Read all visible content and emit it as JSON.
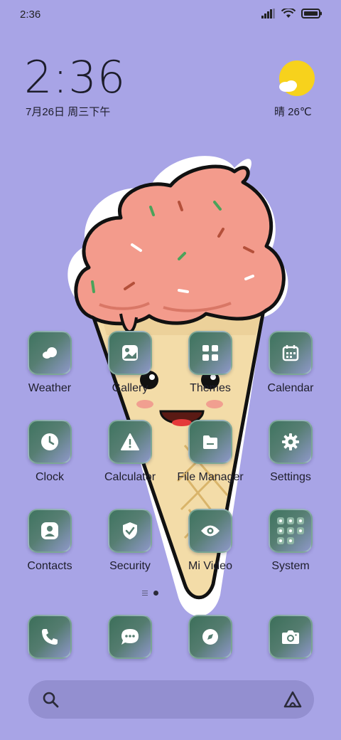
{
  "status": {
    "time": "2:36"
  },
  "clock_widget": {
    "time": "2:36",
    "date": "7月26日 周三下午"
  },
  "weather": {
    "text": "晴 26℃",
    "icon": "sun-cloud-icon"
  },
  "apps": [
    {
      "label": "Weather",
      "icon": "weather-icon"
    },
    {
      "label": "Gallery",
      "icon": "gallery-icon"
    },
    {
      "label": "Themes",
      "icon": "themes-icon"
    },
    {
      "label": "Calendar",
      "icon": "calendar-icon"
    },
    {
      "label": "Clock",
      "icon": "clock-icon"
    },
    {
      "label": "Calculator",
      "icon": "calculator-icon"
    },
    {
      "label": "File Manager",
      "icon": "file-manager-icon"
    },
    {
      "label": "Settings",
      "icon": "settings-icon"
    },
    {
      "label": "Contacts",
      "icon": "contacts-icon"
    },
    {
      "label": "Security",
      "icon": "security-icon"
    },
    {
      "label": "Mi Video",
      "icon": "mi-video-icon"
    },
    {
      "label": "System",
      "icon": "system-folder-icon"
    }
  ],
  "dock": [
    {
      "icon": "phone-icon"
    },
    {
      "icon": "messages-icon"
    },
    {
      "icon": "browser-icon"
    },
    {
      "icon": "camera-icon"
    }
  ],
  "colors": {
    "background": "#a8a4e6",
    "tile_start": "#3f7460",
    "tile_end": "#8e98c9",
    "sun": "#f7d21c"
  }
}
